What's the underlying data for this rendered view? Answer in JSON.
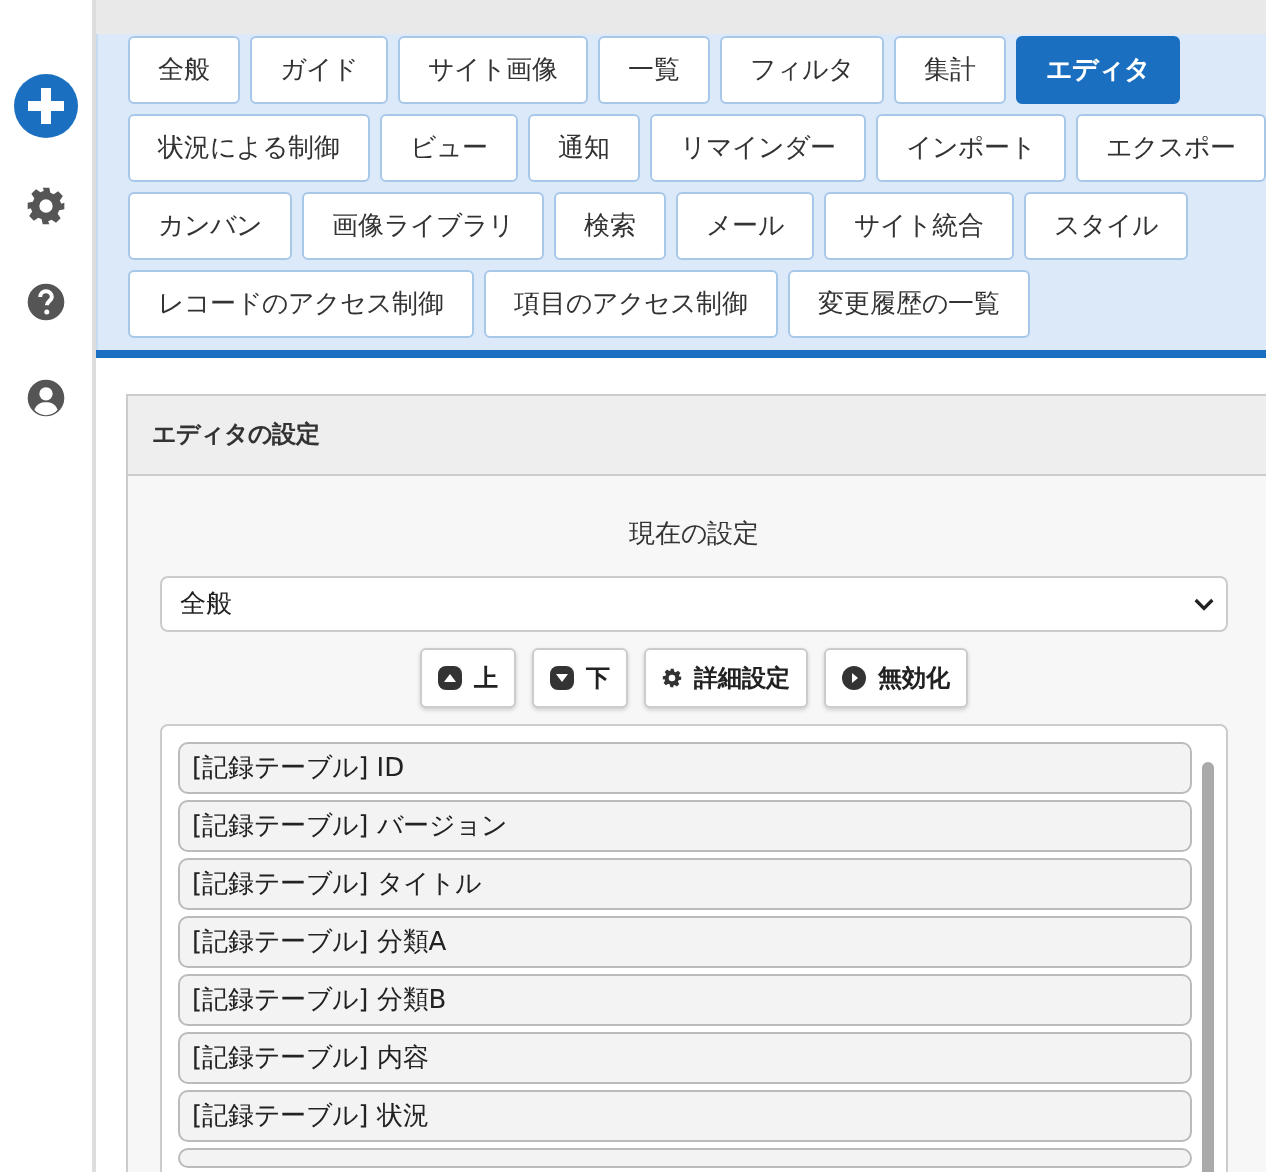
{
  "sidebar": {
    "items": [
      {
        "kind": "add"
      },
      {
        "kind": "settings"
      },
      {
        "kind": "help"
      },
      {
        "kind": "account"
      }
    ]
  },
  "tab_rows": [
    [
      {
        "label": "全般",
        "selected": false
      },
      {
        "label": "ガイド",
        "selected": false
      },
      {
        "label": "サイト画像",
        "selected": false
      },
      {
        "label": "一覧",
        "selected": false
      },
      {
        "label": "フィルタ",
        "selected": false
      },
      {
        "label": "集計",
        "selected": false
      },
      {
        "label": "エディタ",
        "selected": true
      }
    ],
    [
      {
        "label": "状況による制御",
        "selected": false
      },
      {
        "label": "ビュー",
        "selected": false
      },
      {
        "label": "通知",
        "selected": false
      },
      {
        "label": "リマインダー",
        "selected": false
      },
      {
        "label": "インポート",
        "selected": false
      },
      {
        "label": "エクスポー",
        "selected": false
      }
    ],
    [
      {
        "label": "カンバン",
        "selected": false
      },
      {
        "label": "画像ライブラリ",
        "selected": false
      },
      {
        "label": "検索",
        "selected": false
      },
      {
        "label": "メール",
        "selected": false
      },
      {
        "label": "サイト統合",
        "selected": false
      },
      {
        "label": "スタイル",
        "selected": false
      }
    ],
    [
      {
        "label": "レコードのアクセス制御",
        "selected": false
      },
      {
        "label": "項目のアクセス制御",
        "selected": false
      },
      {
        "label": "変更履歴の一覧",
        "selected": false
      }
    ]
  ],
  "panel": {
    "title": "エディタの設定",
    "current_label": "現在の設定",
    "select": {
      "value": "全般"
    },
    "buttons": [
      {
        "label": "上",
        "kind": "up"
      },
      {
        "label": "下",
        "kind": "down"
      },
      {
        "label": "詳細設定",
        "kind": "gear"
      },
      {
        "label": "無効化",
        "kind": "disable"
      }
    ],
    "columns": [
      "[記録テーブル] ID",
      "[記録テーブル] バージョン",
      "[記録テーブル] タイトル",
      "[記録テーブル] 分類A",
      "[記録テーブル] 分類B",
      "[記録テーブル] 内容",
      "[記録テーブル] 状況"
    ]
  }
}
